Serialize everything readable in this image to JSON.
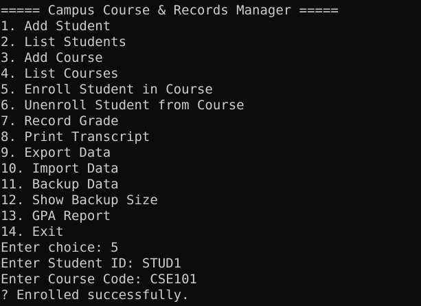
{
  "console": {
    "header": "===== Campus Course & Records Manager =====",
    "menu": [
      "1. Add Student",
      "2. List Students",
      "3. Add Course",
      "4. List Courses",
      "5. Enroll Student in Course",
      "6. Unenroll Student from Course",
      "7. Record Grade",
      "8. Print Transcript",
      "9. Export Data",
      "10. Import Data",
      "11. Backup Data",
      "12. Show Backup Size",
      "13. GPA Report",
      "14. Exit"
    ],
    "prompt_choice": "Enter choice: 5",
    "prompt_student": "Enter Student ID: STUD1",
    "prompt_course": "Enter Course Code: CSE101",
    "result": "? Enrolled successfully."
  },
  "colors": {
    "background": "#0c0c0c",
    "text": "#cccccc"
  }
}
